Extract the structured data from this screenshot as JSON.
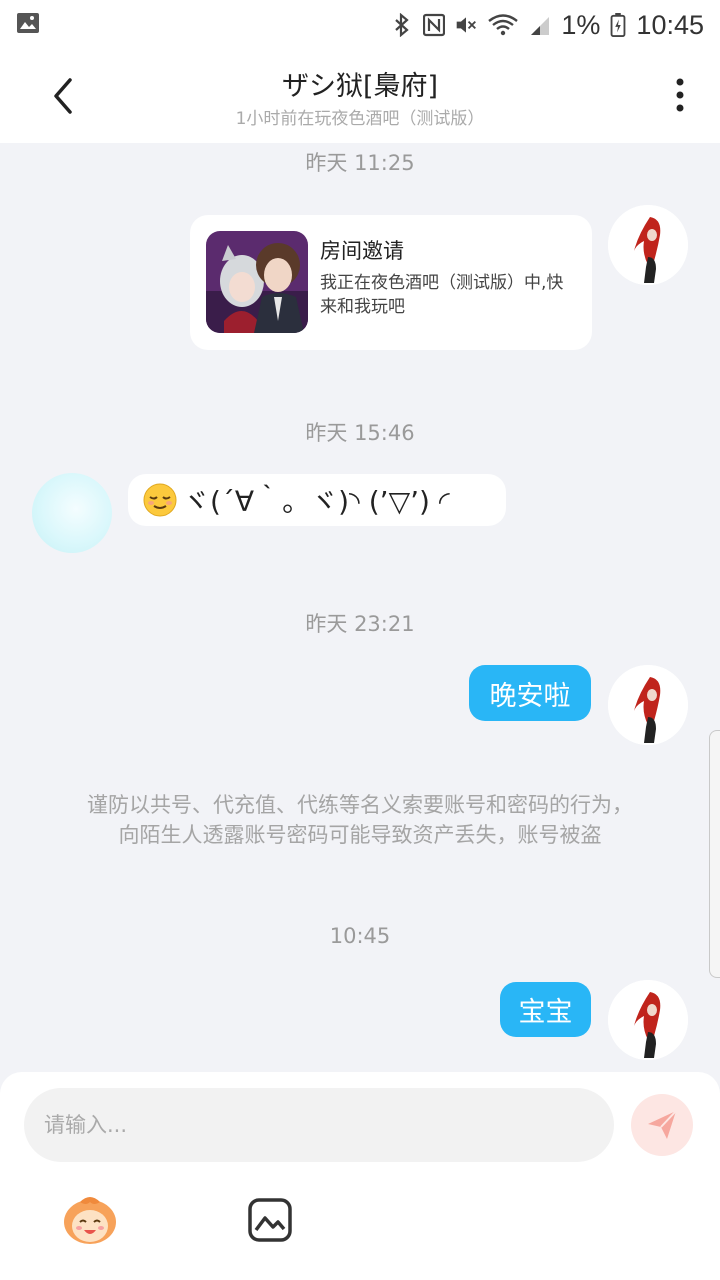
{
  "status_bar": {
    "battery_percent": "1%",
    "time": "10:45",
    "icons": [
      "image-notification-icon",
      "bluetooth-icon",
      "nfc-icon",
      "mute-icon",
      "wifi-icon",
      "signal-icon",
      "battery-icon"
    ]
  },
  "header": {
    "title": "ザシ狱[梟府]",
    "subtitle": "1小时前在玩夜色酒吧（测试版）"
  },
  "messages": {
    "time1": "昨天 11:25",
    "invite": {
      "title": "房间邀请",
      "description": "我正在夜色酒吧（测试版）中,快来和我玩吧"
    },
    "time2": "昨天 15:46",
    "emote_text": "ヾ(´∀｀。ヾ)◝ (’▽’) ◜",
    "time3": "昨天 23:21",
    "bubble1": "晚安啦",
    "warning_line1": "谨防以共号、代充值、代练等名义索要账号和密码的行为，",
    "warning_line2": "向陌生人透露账号密码可能导致资产丢失，账号被盗",
    "time4": "10:45",
    "bubble2": "宝宝"
  },
  "input": {
    "placeholder": "请输入..."
  },
  "colors": {
    "bubble_blue": "#29b6f6",
    "background": "#f2f3f7",
    "send_button": "#fde6e3",
    "send_icon": "#f6a79e"
  }
}
